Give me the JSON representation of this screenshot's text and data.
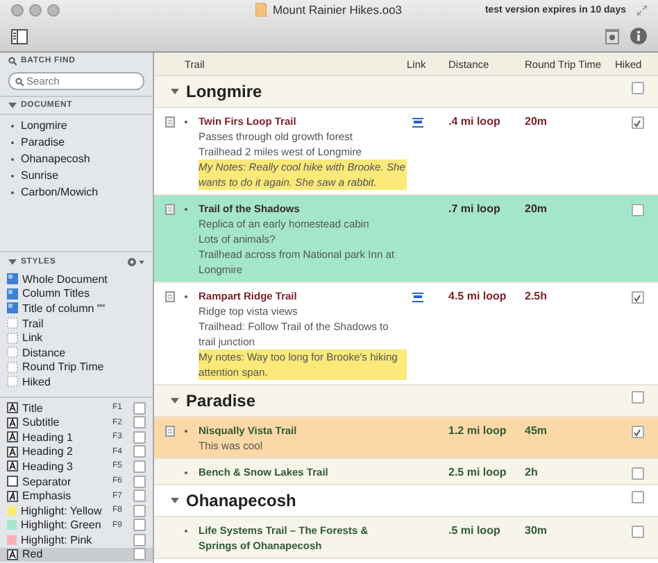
{
  "window": {
    "title": "Mount Rainier Hikes.oo3",
    "notice": "test version expires in 10 days"
  },
  "sidebar": {
    "batch_find": {
      "heading": "BATCH FIND",
      "placeholder": "Search"
    },
    "document": {
      "heading": "DOCUMENT",
      "expanded": true,
      "items": [
        "Longmire",
        "Paradise",
        "Ohanapecosh",
        "Sunrise",
        "Carbon/Mowich"
      ]
    },
    "styles": {
      "heading": "STYLES",
      "expanded": true,
      "items": [
        {
          "kind": "document",
          "label": "Whole Document",
          "selected": false
        },
        {
          "kind": "document",
          "label": "Column Titles",
          "selected": false
        },
        {
          "kind": "document",
          "label": "Title of column \"\"",
          "selected": false
        },
        {
          "kind": "column",
          "label": "Trail",
          "selected": false
        },
        {
          "kind": "column",
          "label": "Link",
          "selected": false
        },
        {
          "kind": "column",
          "label": "Distance",
          "selected": false
        },
        {
          "kind": "column",
          "label": "Round Trip Time",
          "selected": false
        },
        {
          "kind": "column",
          "label": "Hiked",
          "selected": false
        },
        {
          "kind": "text",
          "label": "Title",
          "key": "F1",
          "checked": false,
          "selected": false
        },
        {
          "kind": "text",
          "label": "Subtitle",
          "key": "F2",
          "checked": false,
          "selected": false
        },
        {
          "kind": "text",
          "label": "Heading 1",
          "key": "F3",
          "checked": false,
          "selected": false
        },
        {
          "kind": "text",
          "label": "Heading 2",
          "key": "F4",
          "checked": false,
          "selected": false
        },
        {
          "kind": "text",
          "label": "Heading 3",
          "key": "F5",
          "checked": false,
          "selected": false
        },
        {
          "kind": "separator",
          "label": "Separator",
          "key": "F6",
          "checked": false,
          "selected": false
        },
        {
          "kind": "emphasis",
          "label": "Emphasis",
          "key": "F7",
          "checked": false,
          "selected": false
        },
        {
          "kind": "highlight",
          "label": "Highlight: Yellow",
          "key": "F8",
          "checked": false,
          "selected": false,
          "color": "#fbe97a"
        },
        {
          "kind": "highlight",
          "label": "Highlight: Green",
          "key": "F9",
          "checked": false,
          "selected": false,
          "color": "#a3e6cc"
        },
        {
          "kind": "highlight",
          "label": "Highlight: Pink",
          "checked": false,
          "selected": false,
          "color": "#f7b3b3"
        },
        {
          "kind": "text",
          "label": "Red",
          "checked": false,
          "selected": true
        }
      ]
    }
  },
  "outline": {
    "columns": [
      "Trail",
      "Link",
      "Distance",
      "Round Trip Time",
      "Hiked"
    ],
    "sections": [
      {
        "title": "Longmire",
        "expanded": true,
        "hiked": false,
        "trails": [
          {
            "name": "Twin Firs Loop Trail",
            "kind": "red",
            "has_note": true,
            "link": true,
            "distance": ".4 mi loop",
            "time": "20m",
            "hiked": true,
            "notes": [
              {
                "text": "Passes through old growth forest",
                "highlighted": false,
                "italic": false
              },
              {
                "text": "Trailhead 2 miles west of Longmire",
                "highlighted": false,
                "italic": false
              },
              {
                "text": "My Notes: Really cool hike with Brooke. She wants to do it again. She saw a rabbit.",
                "highlighted": true,
                "italic": true
              }
            ]
          },
          {
            "name": "Trail of the Shadows",
            "kind": "plain",
            "has_note": true,
            "link": false,
            "distance": ".7 mi loop",
            "time": "20m",
            "hiked": false,
            "color": "#a3e6cc",
            "notes": [
              {
                "text": "Replica of an early homestead cabin",
                "highlighted": false,
                "italic": false
              },
              {
                "text": "Lots of animals?",
                "highlighted": false,
                "italic": false
              },
              {
                "text": "Trailhead across from National park Inn at Longmire",
                "highlighted": false,
                "italic": false
              }
            ]
          },
          {
            "name": "Rampart Ridge Trail",
            "kind": "red",
            "has_note": true,
            "link": true,
            "distance": "4.5 mi loop",
            "time": "2.5h",
            "hiked": true,
            "notes": [
              {
                "text": "Ridge top vista views",
                "highlighted": false,
                "italic": false
              },
              {
                "text": "Trailhead: Follow Trail of the Shadows to trail junction",
                "highlighted": false,
                "italic": false
              },
              {
                "text": "My notes: Way too long for Brooke's hiking attention span.",
                "highlighted": true,
                "italic": false
              }
            ]
          }
        ]
      },
      {
        "title": "Paradise",
        "expanded": true,
        "hiked": false,
        "trails": [
          {
            "name": "Nisqually Vista Trail",
            "kind": "green",
            "has_note": true,
            "link": false,
            "distance": "1.2 mi loop",
            "time": "45m",
            "hiked": true,
            "color": "#fbd9a7",
            "notes": [
              {
                "text": "This was cool",
                "highlighted": false,
                "italic": false
              }
            ]
          },
          {
            "name": "Bench & Snow Lakes Trail",
            "kind": "green",
            "has_note": false,
            "link": false,
            "distance": "2.5 mi loop",
            "time": "2h",
            "hiked": false
          }
        ]
      },
      {
        "title": "Ohanapecosh",
        "expanded": true,
        "hiked": false,
        "trails": [
          {
            "name": "Life Systems Trail – The Forests & Springs of Ohanapecosh",
            "kind": "green",
            "has_note": false,
            "link": false,
            "distance": ".5 mi loop",
            "time": "30m",
            "hiked": false
          }
        ]
      }
    ]
  }
}
